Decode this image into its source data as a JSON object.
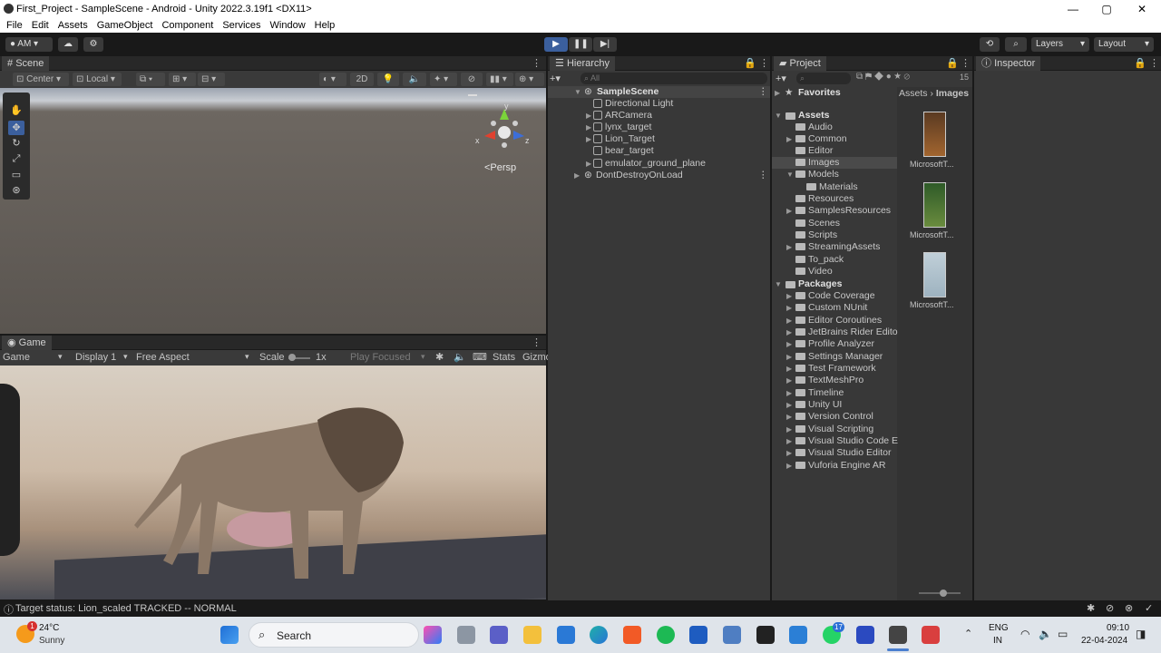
{
  "window": {
    "title": "First_Project - SampleScene - Android - Unity 2022.3.19f1 <DX11>",
    "minimize": "—",
    "maximize": "▢",
    "close": "✕"
  },
  "menu": [
    "File",
    "Edit",
    "Assets",
    "GameObject",
    "Component",
    "Services",
    "Window",
    "Help"
  ],
  "toolbar": {
    "account": "AM",
    "layers": "Layers",
    "layout": "Layout"
  },
  "scene": {
    "tab": "Scene",
    "pivot": "Center",
    "space": "Local",
    "mode2d": "2D",
    "persp": "<Persp",
    "axis_x": "x",
    "axis_z": "z",
    "axis_y": "y"
  },
  "game": {
    "tab": "Game",
    "mode": "Game",
    "display": "Display 1",
    "aspect": "Free Aspect",
    "scale_label": "Scale",
    "scale_value": "1x",
    "play_focused": "Play Focused",
    "stats": "Stats",
    "gizmos": "Gizmo"
  },
  "hierarchy": {
    "tab": "Hierarchy",
    "search_placeholder": "All",
    "scene": "SampleScene",
    "items": [
      "Directional Light",
      "ARCamera",
      "lynx_target",
      "Lion_Target",
      "bear_target",
      "emulator_ground_plane"
    ],
    "dontdestroy": "DontDestroyOnLoad"
  },
  "project": {
    "tab": "Project",
    "favorites": "Favorites",
    "assets": "Assets",
    "asset_folders": [
      "Audio",
      "Common",
      "Editor",
      "Images",
      "Models",
      "Materials",
      "Resources",
      "SamplesResources",
      "Scenes",
      "Scripts",
      "StreamingAssets",
      "To_pack",
      "Video"
    ],
    "packages": "Packages",
    "package_folders": [
      "Code Coverage",
      "Custom NUnit",
      "Editor Coroutines",
      "JetBrains Rider Edito",
      "Profile Analyzer",
      "Settings Manager",
      "Test Framework",
      "TextMeshPro",
      "Timeline",
      "Unity UI",
      "Version Control",
      "Visual Scripting",
      "Visual Studio Code E",
      "Visual Studio Editor",
      "Vuforia Engine AR"
    ],
    "breadcrumb": [
      "Assets",
      "Images"
    ],
    "breadcrumb_sep": "›",
    "files": [
      "MicrosoftT...",
      "MicrosoftT...",
      "MicrosoftT..."
    ],
    "hidden_count": "15"
  },
  "inspector": {
    "tab": "Inspector"
  },
  "status": {
    "text": "Target status: Lion_scaled TRACKED -- NORMAL"
  },
  "taskbar": {
    "weather_temp": "24°C",
    "weather_desc": "Sunny",
    "weather_badge": "1",
    "search": "Search",
    "lang": "ENG",
    "region": "IN",
    "time": "09:10",
    "date": "22-04-2024",
    "whatsapp_badge": "17"
  },
  "colors": {
    "accent": "#3b5f9d",
    "panel": "#383838",
    "dark": "#191919"
  }
}
